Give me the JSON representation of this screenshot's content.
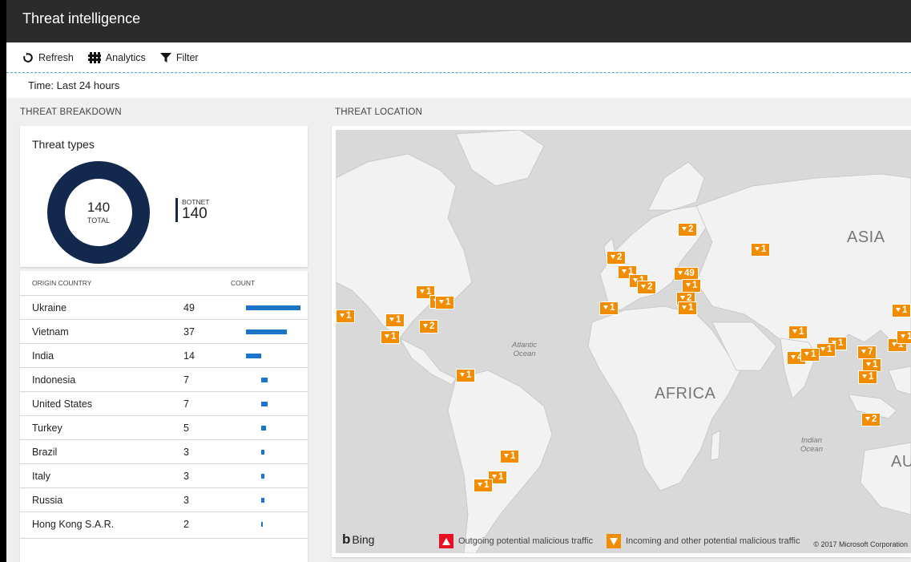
{
  "window": {
    "title": "Threat intelligence"
  },
  "toolbar": {
    "refresh_label": "Refresh",
    "analytics_label": "Analytics",
    "filter_label": "Filter"
  },
  "time_filter": "Time: Last 24 hours",
  "breakdown": {
    "section_title": "THREAT BREAKDOWN",
    "card_title": "Threat types",
    "total_value": "140",
    "total_label": "TOTAL",
    "legend_name": "BOTNET",
    "legend_value": "140",
    "donut_color": "#12284c"
  },
  "table": {
    "col_country": "ORIGIN COUNTRY",
    "col_count": "COUNT",
    "bar_color": "#1a74c8",
    "rows": [
      {
        "country": "Ukraine",
        "count": "49"
      },
      {
        "country": "Vietnam",
        "count": "37"
      },
      {
        "country": "India",
        "count": "14"
      },
      {
        "country": "Indonesia",
        "count": "7"
      },
      {
        "country": "United States",
        "count": "7"
      },
      {
        "country": "Turkey",
        "count": "5"
      },
      {
        "country": "Brazil",
        "count": "3"
      },
      {
        "country": "Italy",
        "count": "3"
      },
      {
        "country": "Russia",
        "count": "3"
      },
      {
        "country": "Hong Kong S.A.R.",
        "count": "2"
      }
    ]
  },
  "location": {
    "section_title": "THREAT LOCATION",
    "labels": {
      "asia": "ASIA",
      "africa": "AFRICA",
      "australia_partial": "AU",
      "atlantic_1": "Atlantic",
      "atlantic_2": "Ocean",
      "indian_1": "Indian",
      "indian_2": "Ocean"
    },
    "markers": [
      "2",
      "1",
      "2",
      "1",
      "1",
      "49",
      "2",
      "2",
      "1",
      "1",
      "1",
      "1",
      "1",
      "1",
      "2",
      "1",
      "1",
      "1",
      "1",
      "1",
      "1",
      "1",
      "4",
      "1",
      "7",
      "1",
      "1",
      "1",
      "2",
      "1",
      "1",
      "1",
      "1",
      "1"
    ],
    "bing_label": "Bing",
    "legend_outgoing": "Outgoing potential malicious traffic",
    "legend_incoming": "Incoming and other potential malicious traffic",
    "copyright": "© 2017 Microsoft Corporation",
    "marker_color": "#f28c00",
    "outgoing_color": "#e81123"
  }
}
